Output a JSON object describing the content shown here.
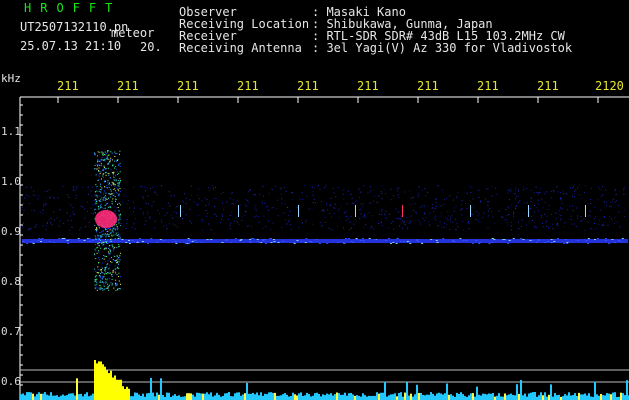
{
  "header": {
    "brand": "HROFFT",
    "filename": "UT2507132110.pn",
    "meteor_label": "meteor",
    "timestamp": "25.07.13 21:10",
    "seconds": "20."
  },
  "info": [
    {
      "label": "Observer",
      "value": ": Masaki Kano"
    },
    {
      "label": "Receiving Location",
      "value": ": Shibukawa, Gunma, Japan"
    },
    {
      "label": "Receiver",
      "value": ": RTL-SDR SDR# 43dB L15 103.2MHz CW"
    },
    {
      "label": "Receiving Antenna",
      "value": ": 3el Yagi(V) Az 330 for Vladivostok"
    }
  ],
  "axis": {
    "y_unit": "kHz",
    "x_ticks": [
      "211",
      "211",
      "211",
      "211",
      "211",
      "211",
      "211",
      "211",
      "211",
      "2120"
    ],
    "y_ticks": [
      "1.1",
      "1.0",
      "0.9",
      "0.8",
      "0.7",
      "0.6"
    ]
  },
  "colors": {
    "background": "#000000",
    "carrier": "#2a3cff",
    "burst": "#ff2a7a",
    "tick_text": "#e6e62e",
    "amplitude_signal": "#ffff00",
    "amplitude_noise": "#22c8ff"
  }
}
